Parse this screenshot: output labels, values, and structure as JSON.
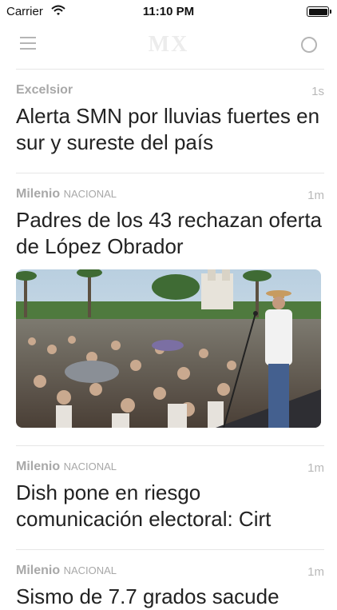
{
  "status_bar": {
    "carrier": "Carrier",
    "time": "11:10 PM"
  },
  "nav": {
    "logo": "MX",
    "left_icon": "menu-icon",
    "right_icon": "circle-icon"
  },
  "stories": [
    {
      "source": "Excelsior",
      "section": "",
      "age": "1s",
      "headline": "Alerta SMN por lluvias fuertes en sur y sureste del país"
    },
    {
      "source": "Milenio",
      "section": "NACIONAL",
      "age": "1m",
      "headline": "Padres de los 43 rechazan oferta de López Obrador",
      "image": "rally-crowd-photo"
    },
    {
      "source": "Milenio",
      "section": "NACIONAL",
      "age": "1m",
      "headline": "Dish pone en riesgo comunicación electoral: Cirt"
    },
    {
      "source": "Milenio",
      "section": "NACIONAL",
      "age": "1m",
      "headline": "Sismo de 7.7 grados sacude"
    }
  ],
  "colors": {
    "meta_text": "#a8a8a8",
    "divider": "#e6e6e6",
    "logo": "#ececec"
  }
}
